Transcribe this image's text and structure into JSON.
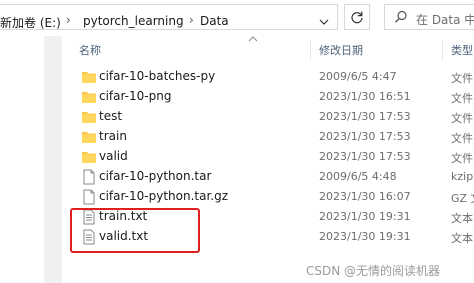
{
  "address": {
    "crumbs": [
      "新加卷 (E:)",
      "pytorch_learning",
      "Data"
    ],
    "separator": "›"
  },
  "search": {
    "placeholder": "在 Data 中搜"
  },
  "columns": {
    "name": "名称",
    "date": "修改日期",
    "type": "类型"
  },
  "files": [
    {
      "name": "cifar-10-batches-py",
      "date": "2009/6/5 4:47",
      "type": "文件",
      "kind": "folder"
    },
    {
      "name": "cifar-10-png",
      "date": "2023/1/30 16:51",
      "type": "文件",
      "kind": "folder"
    },
    {
      "name": "test",
      "date": "2023/1/30 17:53",
      "type": "文件",
      "kind": "folder"
    },
    {
      "name": "train",
      "date": "2023/1/30 17:53",
      "type": "文件",
      "kind": "folder"
    },
    {
      "name": "valid",
      "date": "2023/1/30 17:53",
      "type": "文件",
      "kind": "folder"
    },
    {
      "name": "cifar-10-python.tar",
      "date": "2009/6/5 4:48",
      "type": "kzip",
      "kind": "file"
    },
    {
      "name": "cifar-10-python.tar.gz",
      "date": "2023/1/30 16:07",
      "type": "GZ 文",
      "kind": "file"
    },
    {
      "name": "train.txt",
      "date": "2023/1/30 19:31",
      "type": "文本",
      "kind": "text"
    },
    {
      "name": "valid.txt",
      "date": "2023/1/30 19:31",
      "type": "文本",
      "kind": "text"
    }
  ],
  "watermark": "CSDN @无情的阅读机器",
  "colors": {
    "folder": "#f8c94a",
    "highlight": "#e02020",
    "header_text": "#4c607a"
  }
}
